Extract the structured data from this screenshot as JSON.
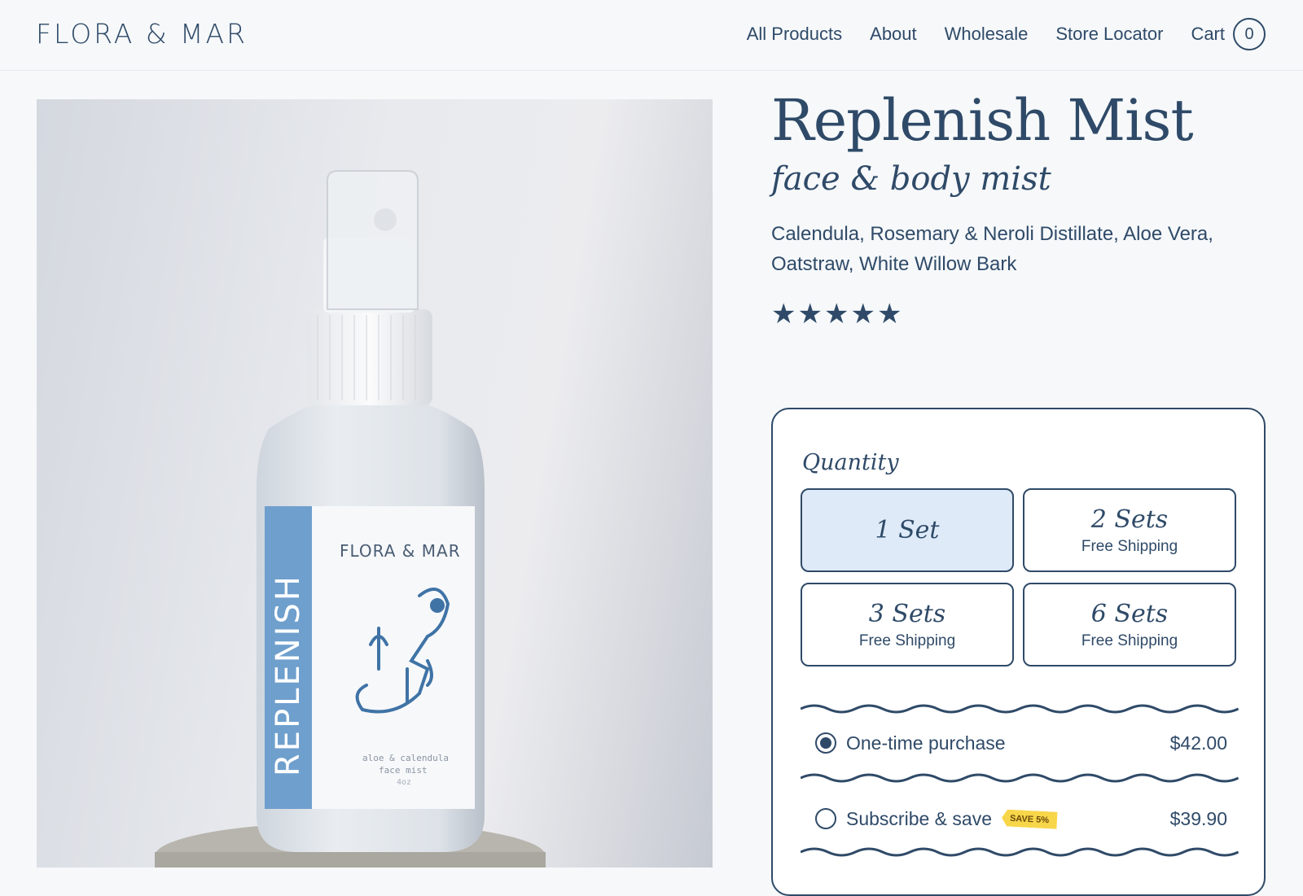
{
  "brand": {
    "logo_text": "FLORA & MAR"
  },
  "nav": {
    "items": [
      "All Products",
      "About",
      "Wholesale",
      "Store Locator"
    ],
    "cart_label": "Cart",
    "cart_count": "0"
  },
  "product": {
    "title": "Replenish Mist",
    "subtitle": "face & body mist",
    "ingredients": "Calendula, Rosemary & Neroli Distillate, Aloe Vera, Oatstraw, White Willow Bark",
    "rating": 5,
    "image": {
      "label_side_text": "REPLENISH",
      "label_brand": "FLORA & MAR",
      "label_line1": "aloe & calendula",
      "label_line2": "face mist",
      "label_size": "4oz"
    }
  },
  "quantity": {
    "label": "Quantity",
    "options": [
      {
        "name": "1 Set",
        "note": ""
      },
      {
        "name": "2 Sets",
        "note": "Free Shipping"
      },
      {
        "name": "3 Sets",
        "note": "Free Shipping"
      },
      {
        "name": "6 Sets",
        "note": "Free Shipping"
      }
    ],
    "selected_index": 0
  },
  "purchase": {
    "one_time": {
      "label": "One-time purchase",
      "price": "$42.00",
      "selected": true
    },
    "subscribe": {
      "label": "Subscribe & save",
      "badge": "SAVE 5%",
      "price": "$39.90",
      "selected": false
    }
  },
  "colors": {
    "primary": "#2f4a68",
    "selected_bg": "#deeaf8",
    "label_blue": "#6f9fcd",
    "badge": "#f7d64a"
  }
}
